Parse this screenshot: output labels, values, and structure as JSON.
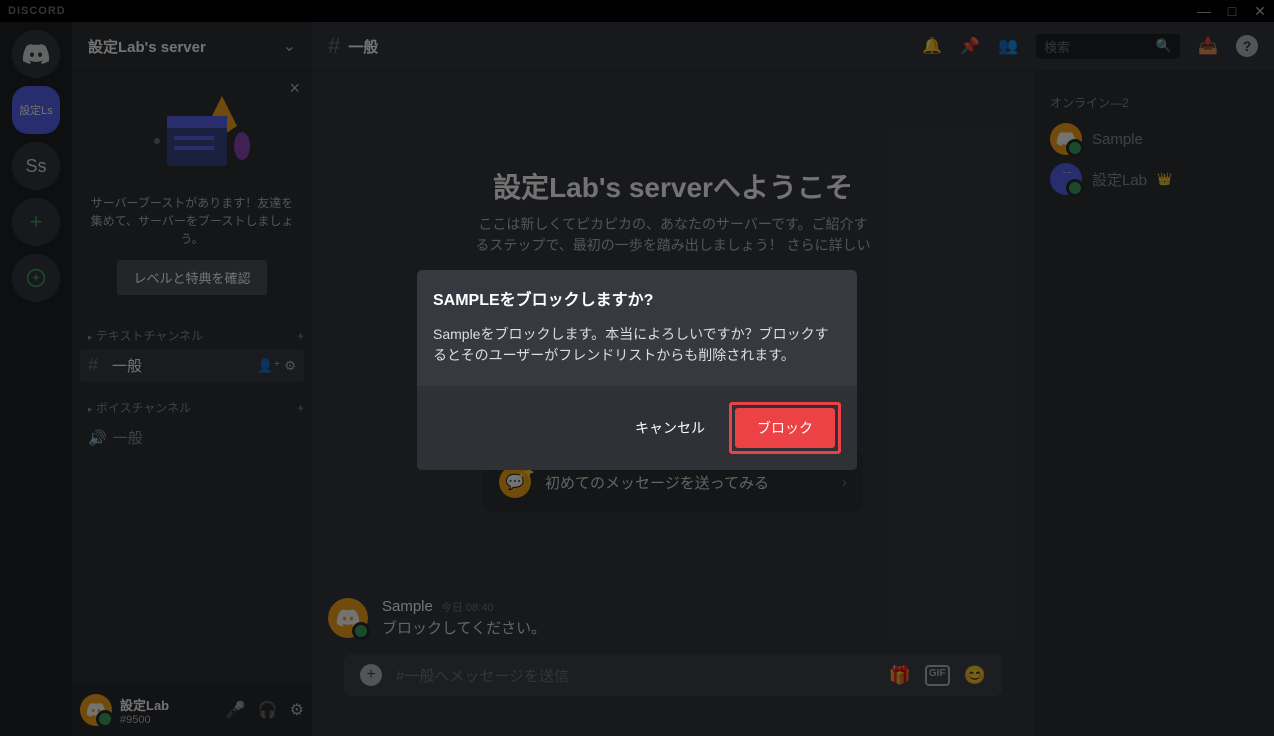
{
  "app_name": "DISCORD",
  "window": {
    "min": "—",
    "max": "□",
    "close": "✕"
  },
  "guilds": {
    "selected_label": "設定Ls",
    "ss": "Ss"
  },
  "server": {
    "name": "設定Lab's server",
    "boost": {
      "text": "サーバーブーストがあります！友達を集めて、サーバーをブーストしましょう。",
      "button": "レベルと特典を確認"
    },
    "text_cat": "テキストチャンネル",
    "voice_cat": "ボイスチャンネル",
    "channel_general": "一般",
    "voice_general": "一般"
  },
  "user": {
    "name": "設定Lab",
    "tag": "#9500"
  },
  "chat": {
    "channel": "一般",
    "search_placeholder": "検索",
    "welcome_title": "設定Lab's serverへようこそ",
    "welcome_sub": "ここは新しくてピカピカの、あなたのサーバーです。ご紹介するステップで、最初の一歩を踏み出しましょう！ さらに詳しい",
    "action_send_first": "初めてのメッセージを送ってみる",
    "msg_author": "Sample",
    "msg_time": "今日 08:40",
    "msg_text": "ブロックしてください。",
    "composer_placeholder": "#一般へメッセージを送信"
  },
  "members": {
    "cat": "オンライン—2",
    "m1": "Sample",
    "m2": "設定Lab"
  },
  "modal": {
    "title": "SAMPLEをブロックしますか?",
    "text": "Sampleをブロックします。本当によろしいですか？ブロックするとそのユーザーがフレンドリストからも削除されます。",
    "cancel": "キャンセル",
    "block": "ブロック"
  }
}
